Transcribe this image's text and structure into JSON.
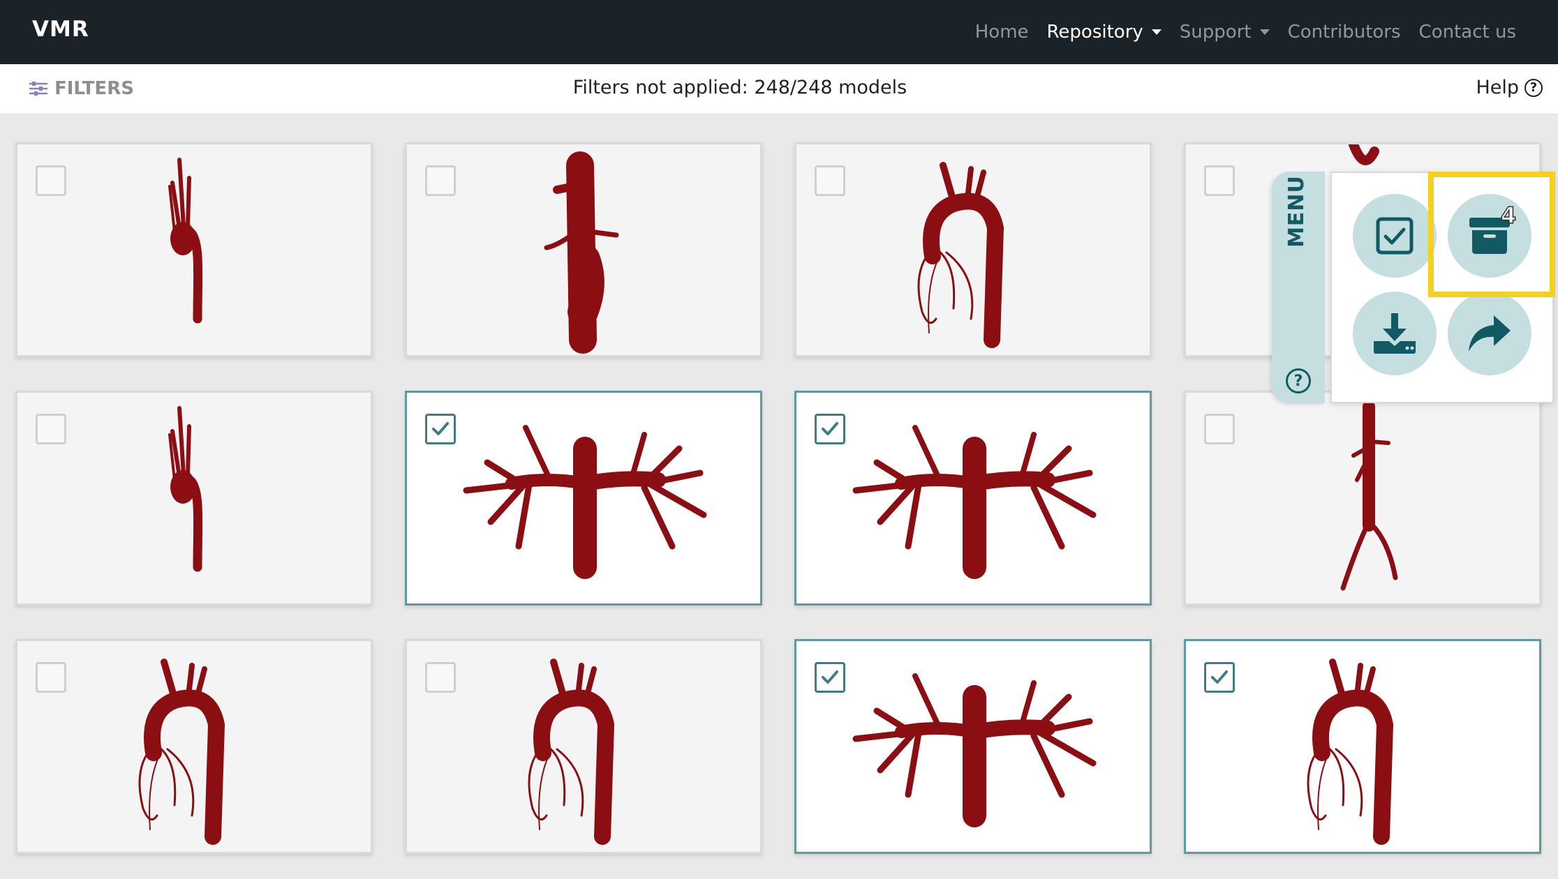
{
  "brand": "VMR",
  "nav": {
    "home": "Home",
    "repository": "Repository",
    "support": "Support",
    "contributors": "Contributors",
    "contact": "Contact us"
  },
  "filterbar": {
    "filters_label": "FILTERS",
    "status": "Filters not applied: 248/248 models",
    "help_label": "Help"
  },
  "model_cards": [
    {
      "selected": false,
      "icon": "aorta-arch-model"
    },
    {
      "selected": false,
      "icon": "aorta-segment-model"
    },
    {
      "selected": false,
      "icon": "aortic-arch-coronary-model"
    },
    {
      "selected": false,
      "icon": "heart-model-partial"
    },
    {
      "selected": false,
      "icon": "aorta-arch-model"
    },
    {
      "selected": true,
      "icon": "pulmonary-tree-model"
    },
    {
      "selected": true,
      "icon": "pulmonary-tree-model"
    },
    {
      "selected": false,
      "icon": "abdominal-aorta-model"
    },
    {
      "selected": false,
      "icon": "aortic-arch-coronary-model"
    },
    {
      "selected": false,
      "icon": "aortic-arch-coronary-model"
    },
    {
      "selected": true,
      "icon": "pulmonary-tree-model"
    },
    {
      "selected": true,
      "icon": "aortic-arch-coronary-model"
    }
  ],
  "menu": {
    "label": "MENU",
    "help_glyph": "?",
    "cart_count": "4",
    "buttons": [
      "select-all-icon",
      "archive-icon",
      "download-icon",
      "share-icon"
    ]
  },
  "colors": {
    "navbar": "#1b2329",
    "accent": "#125a63",
    "menu_bg": "#c5dfe1",
    "highlight": "#f4d020",
    "vessel": "#8b0e12",
    "selected_border": "#5f9aa0"
  }
}
